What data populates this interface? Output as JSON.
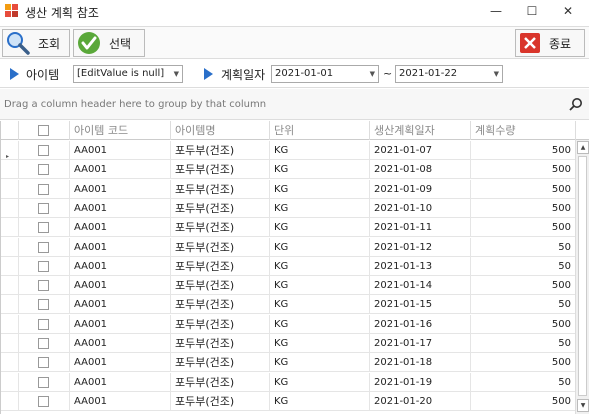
{
  "window": {
    "title": "생산 계획 참조",
    "minimize": "—",
    "maximize": "☐",
    "close": "✕",
    "icon": "app-logo-icon"
  },
  "toolbar": {
    "search_label": "조회",
    "select_label": "선택",
    "exit_label": "종료"
  },
  "filters": {
    "item_label": "아이템",
    "item_value": "[EditValue is null]",
    "date_label": "계획일자",
    "date_from": "2021-01-01",
    "date_separator": "~",
    "date_to": "2021-01-22"
  },
  "grid": {
    "group_hint": "Drag a column header here to group by that column",
    "columns": [
      "아이템 코드",
      "아이템명",
      "단위",
      "생산계획일자",
      "계획수량"
    ],
    "rows": [
      {
        "code": "AA001",
        "name": "포두부(건조)",
        "unit": "KG",
        "date": "2021-01-07",
        "qty": "500"
      },
      {
        "code": "AA001",
        "name": "포두부(건조)",
        "unit": "KG",
        "date": "2021-01-08",
        "qty": "500"
      },
      {
        "code": "AA001",
        "name": "포두부(건조)",
        "unit": "KG",
        "date": "2021-01-09",
        "qty": "500"
      },
      {
        "code": "AA001",
        "name": "포두부(건조)",
        "unit": "KG",
        "date": "2021-01-10",
        "qty": "500"
      },
      {
        "code": "AA001",
        "name": "포두부(건조)",
        "unit": "KG",
        "date": "2021-01-11",
        "qty": "500"
      },
      {
        "code": "AA001",
        "name": "포두부(건조)",
        "unit": "KG",
        "date": "2021-01-12",
        "qty": "50"
      },
      {
        "code": "AA001",
        "name": "포두부(건조)",
        "unit": "KG",
        "date": "2021-01-13",
        "qty": "50"
      },
      {
        "code": "AA001",
        "name": "포두부(건조)",
        "unit": "KG",
        "date": "2021-01-14",
        "qty": "500"
      },
      {
        "code": "AA001",
        "name": "포두부(건조)",
        "unit": "KG",
        "date": "2021-01-15",
        "qty": "50"
      },
      {
        "code": "AA001",
        "name": "포두부(건조)",
        "unit": "KG",
        "date": "2021-01-16",
        "qty": "500"
      },
      {
        "code": "AA001",
        "name": "포두부(건조)",
        "unit": "KG",
        "date": "2021-01-17",
        "qty": "50"
      },
      {
        "code": "AA001",
        "name": "포두부(건조)",
        "unit": "KG",
        "date": "2021-01-18",
        "qty": "500"
      },
      {
        "code": "AA001",
        "name": "포두부(건조)",
        "unit": "KG",
        "date": "2021-01-19",
        "qty": "50"
      },
      {
        "code": "AA001",
        "name": "포두부(건조)",
        "unit": "KG",
        "date": "2021-01-20",
        "qty": "500"
      }
    ]
  },
  "colors": {
    "accent_blue": "#2a6fc9",
    "check_green": "#5aa83a",
    "exit_red": "#d9352b"
  }
}
